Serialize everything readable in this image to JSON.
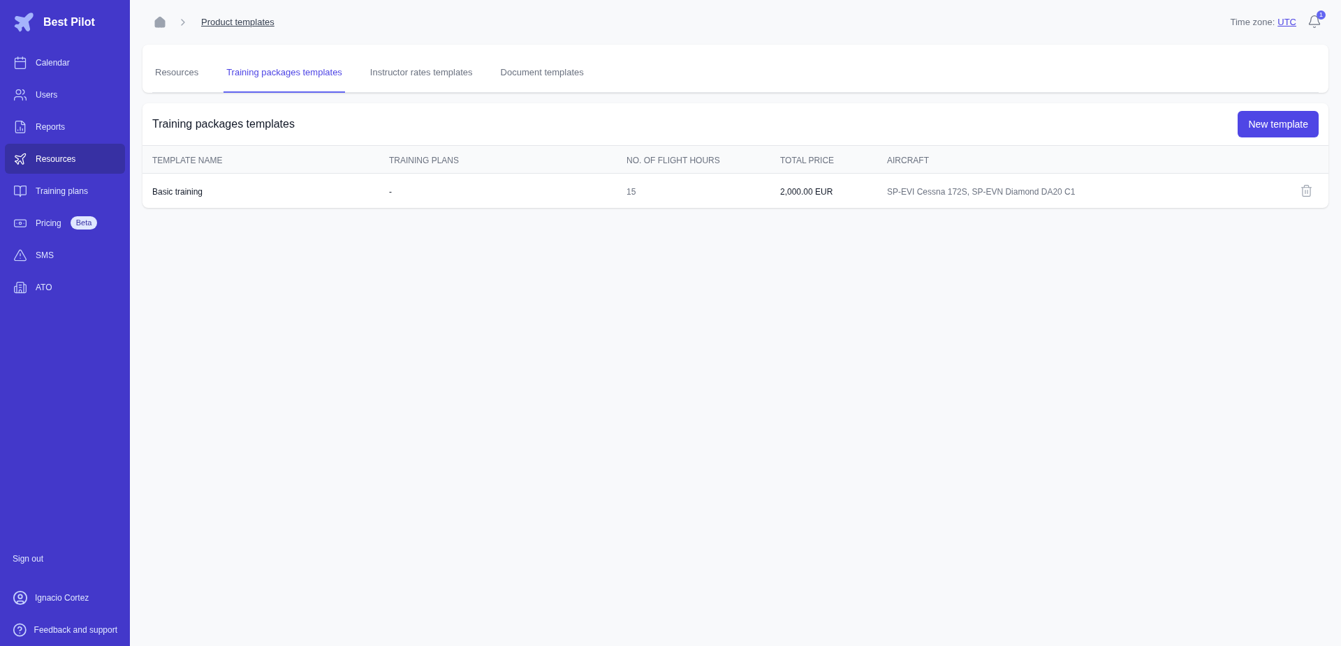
{
  "sidebar": {
    "brand": "Best Pilot",
    "items": [
      {
        "label": "Calendar",
        "selected": false
      },
      {
        "label": "Users",
        "selected": false
      },
      {
        "label": "Reports",
        "selected": false
      },
      {
        "label": "Resources",
        "selected": true
      },
      {
        "label": "Training plans",
        "selected": false
      },
      {
        "label": "Pricing",
        "selected": false,
        "badge": "Beta"
      },
      {
        "label": "SMS",
        "selected": false
      },
      {
        "label": "ATO",
        "selected": false
      }
    ],
    "sign_out": "Sign out",
    "user": "Ignacio Cortez",
    "feedback": "Feedback and support"
  },
  "header": {
    "breadcrumb": "Product templates",
    "time_zone_label": "Time zone:",
    "time_zone": "UTC",
    "notifications": "1"
  },
  "tabs": [
    {
      "label": "Resources",
      "selected": false
    },
    {
      "label": "Training packages templates",
      "selected": true
    },
    {
      "label": "Instructor rates templates",
      "selected": false
    },
    {
      "label": "Document templates",
      "selected": false
    }
  ],
  "panel": {
    "title": "Training packages templates",
    "button": "New template",
    "columns": [
      "TEMPLATE NAME",
      "TRAINING PLANS",
      "NO. OF FLIGHT HOURS",
      "TOTAL PRICE",
      "AIRCRAFT"
    ],
    "rows": [
      {
        "cells": [
          "Basic training",
          "-",
          "15",
          "2,000.00 EUR",
          "SP-EVI Cessna 172S, SP-EVN Diamond DA20 C1"
        ]
      }
    ]
  }
}
